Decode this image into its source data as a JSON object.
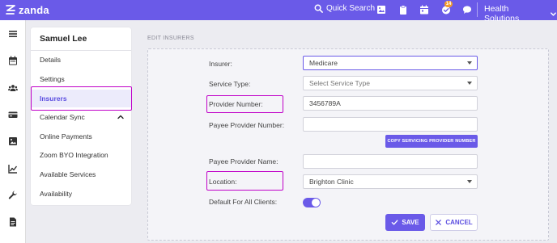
{
  "app": {
    "brand": "zanda",
    "quick_search_label": "Quick Search",
    "notification_count": "14",
    "organization": "Health Solutions"
  },
  "sidebar": {
    "title": "Samuel Lee",
    "items": [
      {
        "label": "Details"
      },
      {
        "label": "Settings"
      },
      {
        "label": "Insurers",
        "active": true
      },
      {
        "label": "Calendar Sync",
        "expandable": true
      },
      {
        "label": "Online Payments"
      },
      {
        "label": "Zoom BYO Integration"
      },
      {
        "label": "Available Services"
      },
      {
        "label": "Availability"
      }
    ]
  },
  "form": {
    "section_label": "EDIT INSURERS",
    "insurer": {
      "label": "Insurer:",
      "value": "Medicare"
    },
    "service_type": {
      "label": "Service Type:",
      "placeholder": "Select Service Type"
    },
    "provider_number": {
      "label": "Provider Number:",
      "value": "3456789A"
    },
    "payee_provider_number": {
      "label": "Payee Provider Number:",
      "value": ""
    },
    "copy_button": "COPY SERVICING PROVIDER NUMBER",
    "payee_provider_name": {
      "label": "Payee Provider Name:",
      "value": ""
    },
    "location": {
      "label": "Location:",
      "value": "Brighton Clinic"
    },
    "default_for_all_clients": {
      "label": "Default For All Clients:",
      "on": true
    },
    "save_label": "SAVE",
    "cancel_label": "CANCEL"
  },
  "colors": {
    "accent": "#6a5ae8",
    "highlight_box": "#c000c8",
    "badge": "#f39c2c"
  }
}
